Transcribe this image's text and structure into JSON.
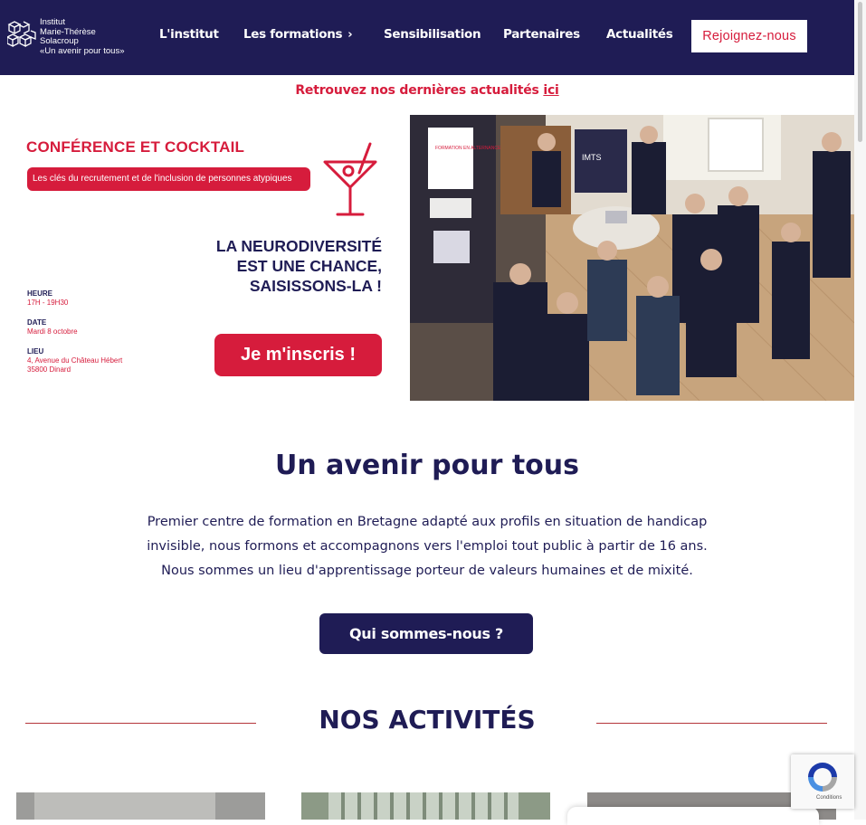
{
  "header": {
    "logo": {
      "line1": "Institut",
      "line2": "Marie-Thérèse",
      "line3": "Solacroup",
      "tagline": "«Un avenir pour tous»"
    },
    "nav": [
      {
        "label": "L'institut"
      },
      {
        "label": "Les formations"
      },
      {
        "label": "Sensibilisation"
      },
      {
        "label": "Partenaires"
      },
      {
        "label": "Actualités"
      }
    ],
    "join_label": "Rejoignez-nous"
  },
  "news_bar": {
    "text": "Retrouvez nos dernières actualités ",
    "link": "ici"
  },
  "banner": {
    "title": "CONFÉRENCE ET COCKTAIL",
    "subtitle": "Les clés du recrutement et de l'inclusion de personnes atypiques",
    "headline_1": "LA NEURODIVERSITÉ",
    "headline_2": "EST UNE CHANCE,",
    "headline_3": "SAISISSONS-LA !",
    "heure_label": "HEURE",
    "heure_value": "17H - 19H30",
    "date_label": "DATE",
    "date_value": "Mardi 8 octobre",
    "lieu_label": "LIEU",
    "lieu_value_1": "4, Avenue du Château Hébert",
    "lieu_value_2": "35800 Dinard",
    "cta": "Je m'inscris !",
    "poster_1": "IMTS",
    "poster_2": "FORMATION EN ALTERNANCE"
  },
  "hero": {
    "title": "Un avenir pour tous",
    "line1": "Premier centre de formation en Bretagne adapté aux profils en situation de handicap",
    "line2": "invisible, nous formons et accompagnons vers l'emploi tout public à partir de 16 ans.",
    "line3": "Nous sommes un lieu d'apprentissage porteur de valeurs humaines et de mixité.",
    "button": "Qui sommes-nous ?"
  },
  "activities": {
    "title": "NOS ACTIVITÉS"
  },
  "recaptcha": {
    "text": "Conditions"
  },
  "colors": {
    "navy": "#1f1c55",
    "red": "#d61c3c"
  }
}
